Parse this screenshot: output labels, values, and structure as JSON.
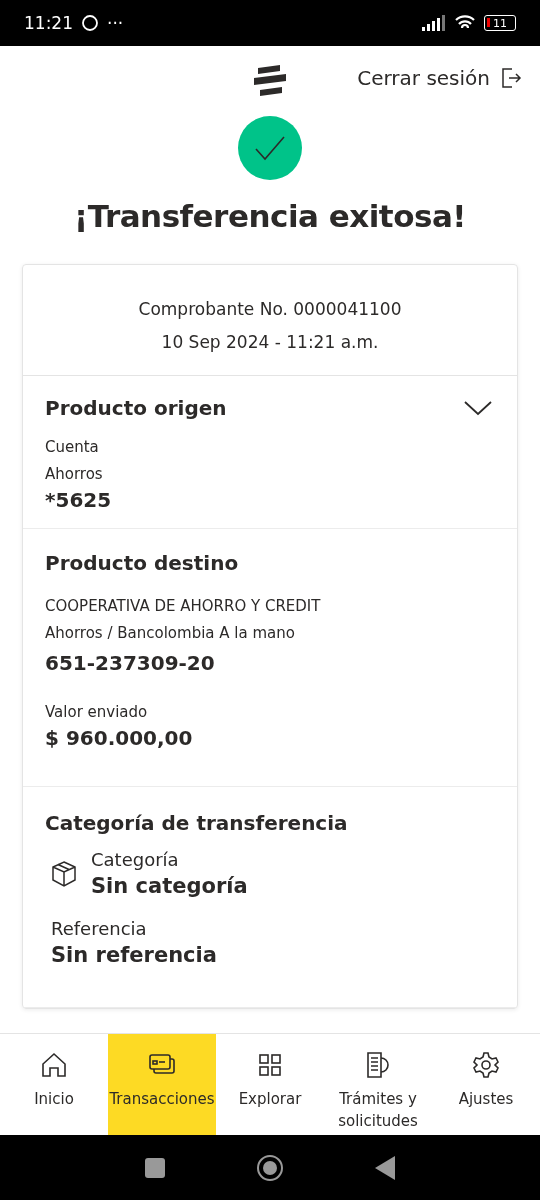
{
  "status_bar": {
    "time": "11:21",
    "more": "···",
    "battery": "11"
  },
  "header": {
    "logout": "Cerrar sesión"
  },
  "title": "¡Transferencia exitosa!",
  "receipt": {
    "number": "Comprobante No. 0000041100",
    "date": "10 Sep 2024 - 11:21 a.m."
  },
  "origin": {
    "heading": "Producto origen",
    "expanded": false,
    "type": "Cuenta",
    "subtype": "Ahorros",
    "account": "*5625"
  },
  "destination": {
    "heading": "Producto destino",
    "name": "COOPERATIVA DE AHORRO Y CREDIT",
    "detail": "Ahorros / Bancolombia A la mano",
    "account": "651-237309-20",
    "amount_label": "Valor enviado",
    "amount": "$ 960.000,00"
  },
  "category": {
    "heading": "Categoría de transferencia",
    "category_label": "Categoría",
    "category_value": "Sin categoría",
    "reference_label": "Referencia",
    "reference_value": "Sin referencia"
  },
  "nav": [
    {
      "kind": "home",
      "label": "Inicio",
      "selected": false
    },
    {
      "kind": "cards",
      "label": "Transacciones",
      "selected": true
    },
    {
      "kind": "grid",
      "label": "Explorar",
      "selected": false
    },
    {
      "kind": "docs",
      "label": "Trámites y solicitudes",
      "selected": false
    },
    {
      "kind": "gear",
      "label": "Ajustes",
      "selected": false
    }
  ]
}
